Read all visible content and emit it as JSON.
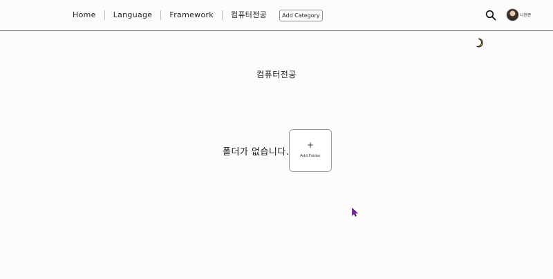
{
  "header": {
    "nav": [
      {
        "label": "Home"
      },
      {
        "label": "Language"
      },
      {
        "label": "Framework"
      },
      {
        "label": "컴퓨터전공"
      }
    ],
    "add_category_label": "Add Category",
    "search_icon": "search-icon",
    "user": {
      "avatar": "avatar",
      "name": "나현준"
    }
  },
  "theme_toggle_icon": "moon-icon",
  "main": {
    "title": "컴퓨터전공",
    "empty_message": "폴더가 없습니다.",
    "add_folder": {
      "plus": "+",
      "label": "Add Folder"
    }
  },
  "colors": {
    "background": "#fdfcfa",
    "moon": "#f2c12e",
    "cursor": "#7b1fa2"
  }
}
